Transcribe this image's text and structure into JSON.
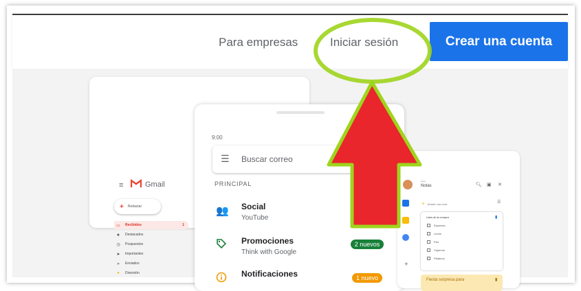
{
  "nav": {
    "empresas": "Para empresas",
    "login": "Iniciar sesión",
    "create": "Crear una cuenta"
  },
  "laptop": {
    "menu_glyph": "≡",
    "app_name": "Gmail",
    "compose": "Redactar",
    "items": [
      {
        "label": "Recibidos",
        "icon": "inbox-icon",
        "glyph": "▭",
        "count": "1"
      },
      {
        "label": "Destacados",
        "icon": "star-icon",
        "glyph": "★",
        "count": ""
      },
      {
        "label": "Pospuestos",
        "icon": "clock-icon",
        "glyph": "◷",
        "count": ""
      },
      {
        "label": "Importantes",
        "icon": "label-icon",
        "glyph": "➤",
        "count": ""
      },
      {
        "label": "Enviados",
        "icon": "send-icon",
        "glyph": "➢",
        "count": ""
      },
      {
        "label": "Diversión",
        "icon": "tag-icon",
        "glyph": "●",
        "count": ""
      }
    ]
  },
  "phone": {
    "time": "9:00",
    "search_placeholder": "Buscar correo",
    "section": "PRINCIPAL",
    "rows": [
      {
        "title": "Social",
        "sub": "YouTube",
        "badge": ""
      },
      {
        "title": "Promociones",
        "sub": "Think with Google",
        "badge": "2 nuevos"
      },
      {
        "title": "Notificaciones",
        "sub": "",
        "badge": "1 nuevo"
      }
    ]
  },
  "tablet": {
    "small": "Keep",
    "title": "Notas",
    "add": "Añadir una nota",
    "list_title": "Lista de la compra",
    "items": [
      "Espresso",
      "Leche",
      "Pan",
      "Cayenne",
      "Plátanos"
    ],
    "note2": "Fiesta sorpresa para"
  },
  "colors": {
    "primary": "#1a73e8",
    "arrow": "#e8262b",
    "highlight": "#9fd41c",
    "gmail_red": "#ea4335",
    "badge_green": "#188038",
    "badge_orange": "#f29900"
  }
}
